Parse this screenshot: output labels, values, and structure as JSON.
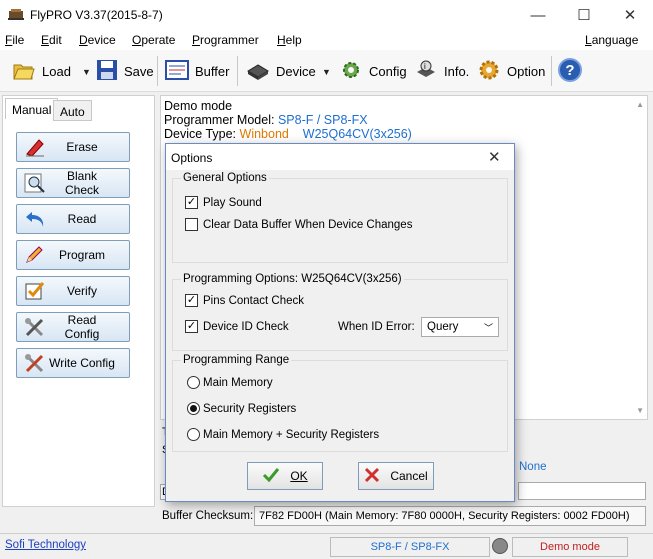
{
  "window": {
    "title": "FlyPRO V3.37(2015-8-7)",
    "minimize": "—",
    "maximize": "☐",
    "close": "✕"
  },
  "menu": {
    "items": [
      "File",
      "Edit",
      "Device",
      "Operate",
      "Programmer",
      "Help"
    ],
    "language": "Language"
  },
  "toolbar": {
    "load": "Load",
    "save": "Save",
    "buffer": "Buffer",
    "device": "Device",
    "config": "Config",
    "info": "Info.",
    "option": "Option"
  },
  "tabs": {
    "manual": "Manual",
    "auto": "Auto"
  },
  "actions": {
    "erase": "Erase",
    "blank_check": "Blank Check",
    "read": "Read",
    "program": "Program",
    "verify": "Verify",
    "read_config": "Read Config",
    "write_config": "Write Config"
  },
  "log": {
    "line1": "Demo mode",
    "model_label": "Programmer Model:",
    "model_value": "SP8-F / SP8-FX",
    "type_label": "Device Type:",
    "vendor": "Winbond",
    "device": "W25Q64CV(3x256)"
  },
  "behind": {
    "none_text": "None",
    "t_char": "T",
    "s_char": "S",
    "d_char": "D"
  },
  "checksum": {
    "label": "Buffer Checksum:",
    "value": "7F82 FD00H (Main Memory: 7F80 0000H, Security Registers: 0002 FD00H)"
  },
  "status": {
    "link": "Sofi Technology",
    "programmer": "SP8-F / SP8-FX",
    "mode": "Demo mode"
  },
  "dialog": {
    "title": "Options",
    "general": {
      "title": "General Options",
      "play_sound": "Play Sound",
      "clear_buffer": "Clear Data Buffer When Device Changes"
    },
    "programming": {
      "title": "Programming Options:  W25Q64CV(3x256)",
      "pins_check": "Pins Contact Check",
      "id_check": "Device ID Check",
      "when_id_error": "When ID Error:",
      "id_error_value": "Query"
    },
    "range": {
      "title": "Programming Range",
      "main": "Main Memory",
      "security": "Security Registers",
      "both": "Main Memory + Security Registers"
    },
    "ok": "OK",
    "cancel": "Cancel"
  },
  "colors": {
    "accent_blue": "#1e6fd0",
    "vendor_orange": "#e07a00",
    "status_red": "#c02020"
  }
}
